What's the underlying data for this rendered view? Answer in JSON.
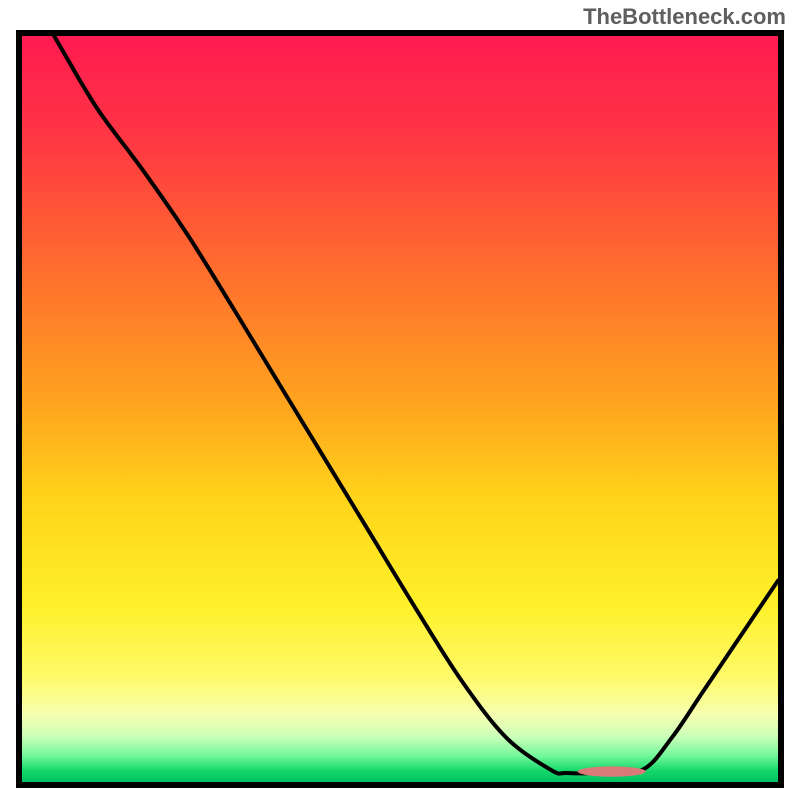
{
  "attribution": "TheBottleneck.com",
  "chart_data": {
    "type": "line",
    "title": "",
    "xlabel": "",
    "ylabel": "",
    "xlim": [
      0,
      1
    ],
    "ylim": [
      0,
      1
    ],
    "x": [
      0.0,
      0.05,
      0.1,
      0.16,
      0.22,
      0.28,
      0.34,
      0.4,
      0.46,
      0.52,
      0.58,
      0.64,
      0.7,
      0.72,
      0.76,
      0.82,
      0.86,
      0.9,
      0.94,
      0.97,
      1.0
    ],
    "values": [
      1.075,
      0.987,
      0.902,
      0.82,
      0.732,
      0.634,
      0.534,
      0.434,
      0.334,
      0.234,
      0.138,
      0.06,
      0.016,
      0.012,
      0.012,
      0.016,
      0.06,
      0.12,
      0.18,
      0.225,
      0.27
    ],
    "marker": {
      "x": 0.78,
      "y": 0.014,
      "rx": 0.045,
      "ry": 0.007
    },
    "gradient_stops": [
      {
        "offset": 0.0,
        "color": "#ff1b50"
      },
      {
        "offset": 0.12,
        "color": "#ff3246"
      },
      {
        "offset": 0.25,
        "color": "#ff5a34"
      },
      {
        "offset": 0.38,
        "color": "#ff8228"
      },
      {
        "offset": 0.5,
        "color": "#ffa61e"
      },
      {
        "offset": 0.62,
        "color": "#ffd41a"
      },
      {
        "offset": 0.76,
        "color": "#fff028"
      },
      {
        "offset": 0.86,
        "color": "#fffa6a"
      },
      {
        "offset": 0.91,
        "color": "#f6ffb0"
      },
      {
        "offset": 0.94,
        "color": "#c8ffb8"
      },
      {
        "offset": 0.965,
        "color": "#72f79a"
      },
      {
        "offset": 0.985,
        "color": "#14d86a"
      },
      {
        "offset": 1.0,
        "color": "#00c060"
      }
    ]
  }
}
